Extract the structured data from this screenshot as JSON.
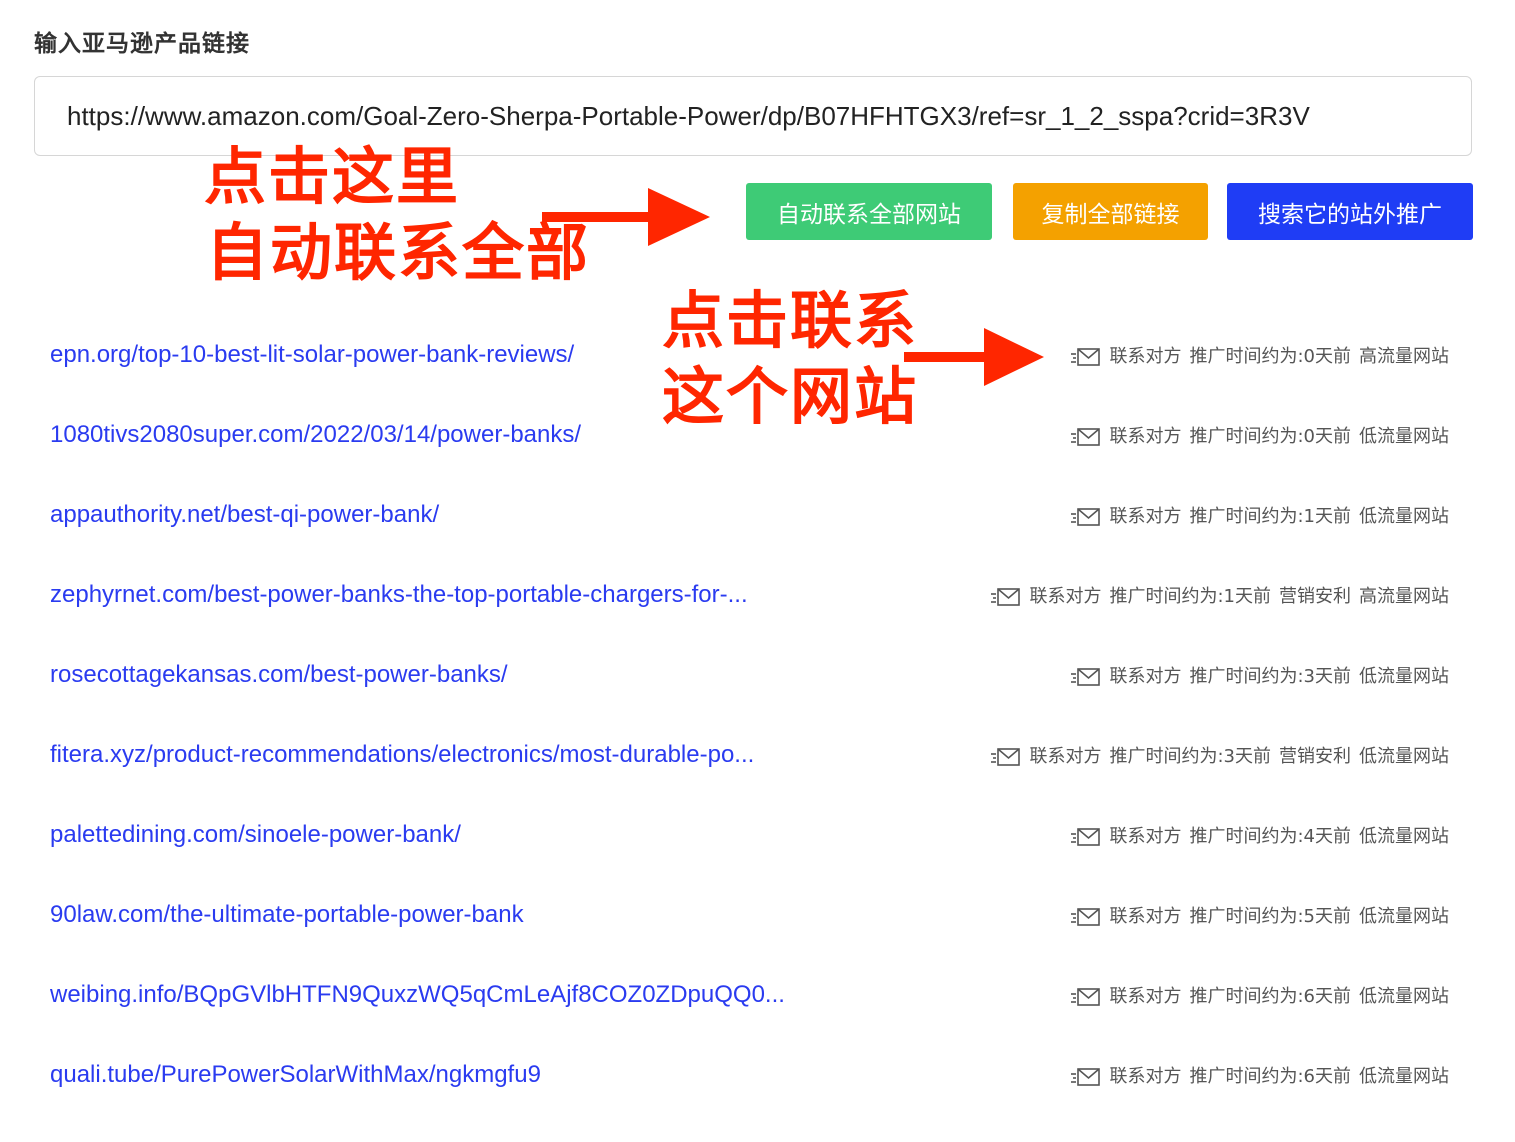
{
  "form": {
    "label": "输入亚马逊产品链接",
    "url_value": "https://www.amazon.com/Goal-Zero-Sherpa-Portable-Power/dp/B07HFHTGX3/ref=sr_1_2_sspa?crid=3R3V"
  },
  "buttons": {
    "auto_contact": "自动联系全部网站",
    "copy_links": "复制全部链接",
    "search_offsite": "搜索它的站外推广"
  },
  "annotations": {
    "note1_line1": "点击这里",
    "note1_line2": "自动联系全部",
    "note2_line1": "点击联系",
    "note2_line2": "这个网站",
    "color": "#ff2600"
  },
  "colors": {
    "link": "#2a3bf0",
    "btn_green": "#3ecb76",
    "btn_orange": "#f4a100",
    "btn_blue": "#1f3df5"
  },
  "contact_label": "联系对方",
  "results": [
    {
      "url": "epn.org/top-10-best-lit-solar-power-bank-reviews/",
      "time": "推广时间约为:0天前",
      "tag": "",
      "traffic": "高流量网站"
    },
    {
      "url": "1080tivs2080super.com/2022/03/14/power-banks/",
      "time": "推广时间约为:0天前",
      "tag": "",
      "traffic": "低流量网站"
    },
    {
      "url": "appauthority.net/best-qi-power-bank/",
      "time": "推广时间约为:1天前",
      "tag": "",
      "traffic": "低流量网站"
    },
    {
      "url": "zephyrnet.com/best-power-banks-the-top-portable-chargers-for-...",
      "time": "推广时间约为:1天前",
      "tag": "营销安利",
      "traffic": "高流量网站"
    },
    {
      "url": "rosecottagekansas.com/best-power-banks/",
      "time": "推广时间约为:3天前",
      "tag": "",
      "traffic": "低流量网站"
    },
    {
      "url": "fitera.xyz/product-recommendations/electronics/most-durable-po...",
      "time": "推广时间约为:3天前",
      "tag": "营销安利",
      "traffic": "低流量网站"
    },
    {
      "url": "palettedining.com/sinoele-power-bank/",
      "time": "推广时间约为:4天前",
      "tag": "",
      "traffic": "低流量网站"
    },
    {
      "url": "90law.com/the-ultimate-portable-power-bank",
      "time": "推广时间约为:5天前",
      "tag": "",
      "traffic": "低流量网站"
    },
    {
      "url": "weibing.info/BQpGVlbHTFN9QuxzWQ5qCmLeAjf8COZ0ZDpuQQ0...",
      "time": "推广时间约为:6天前",
      "tag": "",
      "traffic": "低流量网站"
    },
    {
      "url": "quali.tube/PurePowerSolarWithMax/ngkmgfu9",
      "time": "推广时间约为:6天前",
      "tag": "",
      "traffic": "低流量网站"
    }
  ]
}
